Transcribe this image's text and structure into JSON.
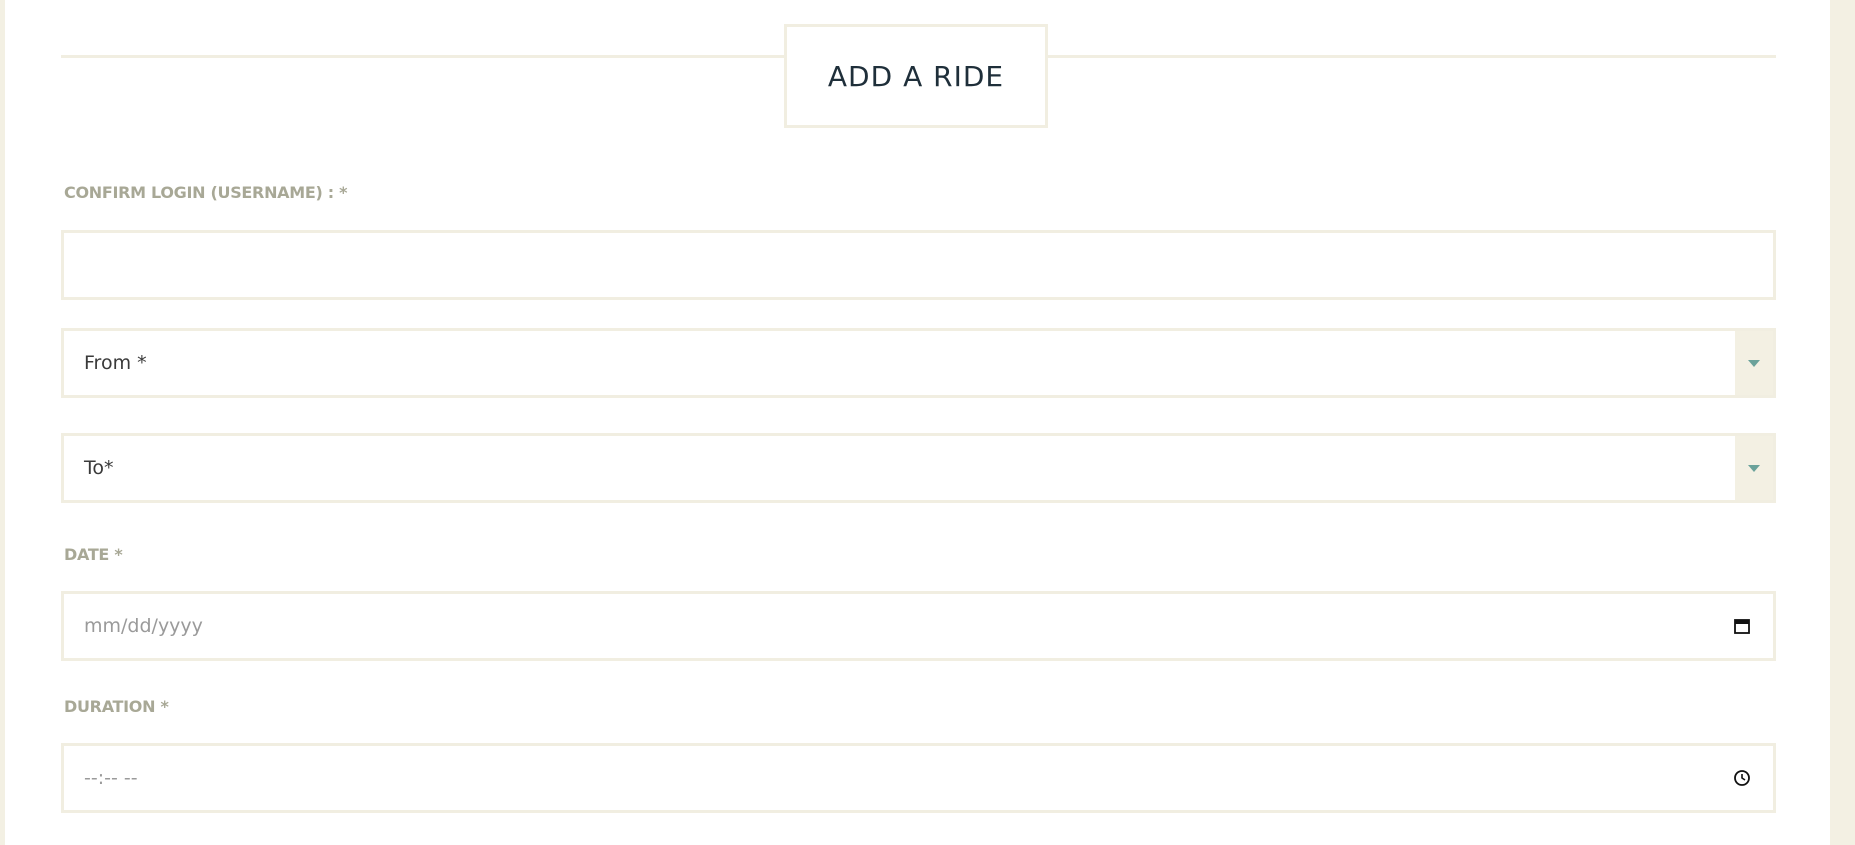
{
  "form": {
    "title": "ADD A RIDE",
    "username_label": "CONFIRM LOGIN (USERNAME) : *",
    "username_value": "",
    "from_placeholder": "From *",
    "to_placeholder": "To*",
    "date_label": "DATE *",
    "date_placeholder": "mm/dd/yyyy",
    "duration_label": "DURATION *",
    "duration_placeholder": "--:-- --"
  },
  "colors": {
    "background": "#f3f0e3",
    "border": "#f1eee1",
    "label": "#a8a896",
    "title": "#1f2f3a",
    "caret": "#6aa29a"
  },
  "icons": {
    "select_arrow": "caret-down-icon",
    "date": "calendar-icon",
    "time": "clock-icon"
  }
}
